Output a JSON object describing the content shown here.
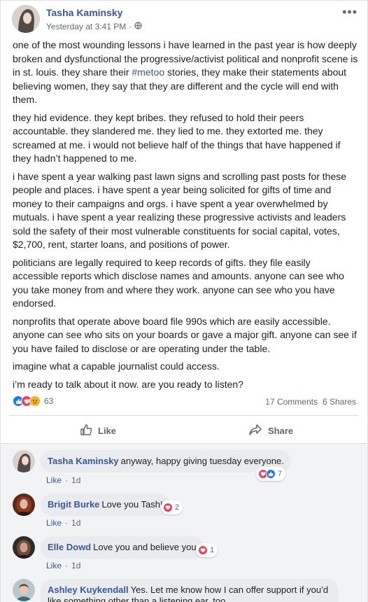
{
  "post": {
    "author": "Tasha Kaminsky",
    "timestamp": "Yesterday at 3:41 PM",
    "separator": "·",
    "paragraphs": [
      "one of the most wounding lessons i have learned in the past year is how deeply broken and dysfunctional the progressive/activist political and nonprofit scene is in st. louis. they share their ",
      "they hid evidence. they kept bribes. they refused to hold their peers accountable. they slandered me. they lied to me. they extorted me. they screamed at me. i would not believe half of the things that have happened if they hadn’t happened to me.",
      "i have spent a year walking past lawn signs and scrolling past posts for these people and places. i have spent a year being solicited for gifts of time and money to their campaigns and orgs. i have spent a year overwhelmed by mutuals. i have spent a year realizing these progressive activists and leaders sold the safety of their most vulnerable constituents for social capital, votes, $2,700, rent, starter loans, and positions of power.",
      "politicians are legally required to keep records of gifts. they file easily accessible reports which disclose names and amounts. anyone can see who you take money from and where they work. anyone can see who you have endorsed.",
      "nonprofits that operate above board file 990s which are easily accessible. anyone can see who sits on your boards or gave a major gift. anyone can see if you have failed to disclose or are operating under the table.",
      "imagine what a capable journalist could access.",
      "i’m ready to talk about it now. are you ready to listen?"
    ],
    "hashtag": "#metoo",
    "paragraph1_rest": " stories, they make their statements about believing women, they say that they are different and the cycle will end with them.",
    "reaction_count": "63",
    "comments_count": "17 Comments",
    "shares_count": "6 Shares",
    "colors": {
      "like_blue": "#1877f2",
      "love_red": "#f33e58",
      "sad_yellow": "#f7b125",
      "link": "#385898"
    }
  },
  "actions": {
    "like": "Like",
    "share": "Share"
  },
  "comments": [
    {
      "name": "Tasha Kaminsky",
      "text": "anyway, happy giving tuesday everyone.",
      "like": "Like",
      "dot": "·",
      "age": "1d",
      "reacts": "7"
    },
    {
      "name": "Brigit Burke",
      "text": "Love you Tash!",
      "like": "Like",
      "dot": "·",
      "age": "1d",
      "reacts": "2"
    },
    {
      "name": "Elle Dowd",
      "text": "Love you and believe you",
      "like": "Like",
      "dot": "·",
      "age": "1d",
      "reacts": "1"
    },
    {
      "name": "Ashley Kuykendall",
      "text": "Yes. Let me know how I can offer support if you’d",
      "text2": "like something other than a listening ear, too."
    }
  ],
  "icons": {
    "more": "more-options-icon",
    "globe": "globe-icon",
    "like": "thumbs-up-icon",
    "share": "share-arrow-icon"
  }
}
